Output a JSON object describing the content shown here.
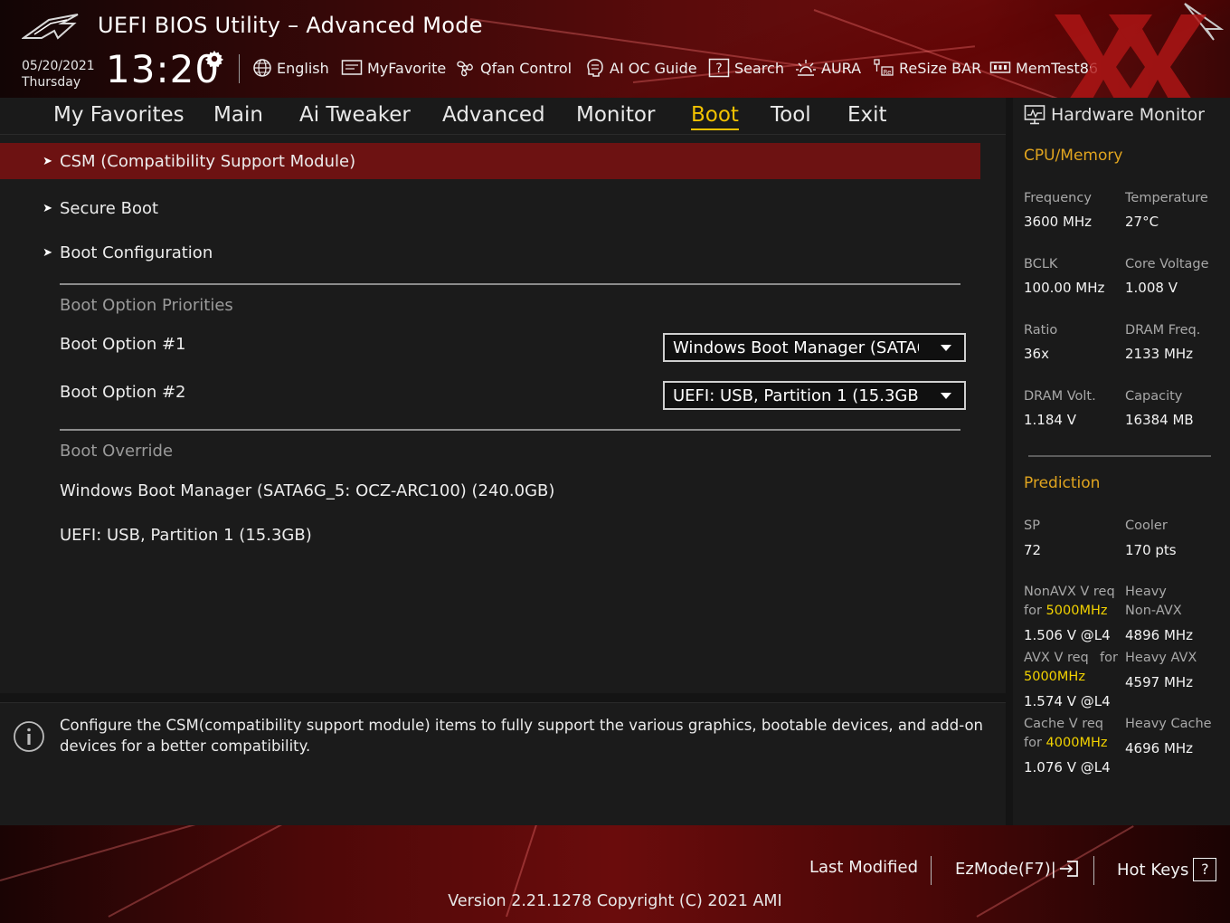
{
  "header": {
    "title": "UEFI BIOS Utility – Advanced Mode",
    "date": "05/20/2021",
    "weekday": "Thursday",
    "time": "13:20",
    "toolbar": {
      "language": "English",
      "myfavorite": "MyFavorite",
      "qfan": "Qfan Control",
      "aioc": "AI OC Guide",
      "search": "Search",
      "aura": "AURA",
      "resize_bar": "ReSize BAR",
      "memtest": "MemTest86"
    }
  },
  "tabs": {
    "my_favorites": "My Favorites",
    "main": "Main",
    "ai_tweaker": "Ai Tweaker",
    "advanced": "Advanced",
    "monitor": "Monitor",
    "boot": "Boot",
    "tool": "Tool",
    "exit": "Exit",
    "active": "Boot"
  },
  "boot": {
    "menu": {
      "csm": "CSM (Compatibility Support Module)",
      "secure_boot": "Secure Boot",
      "boot_config": "Boot Configuration"
    },
    "priorities_header": "Boot Option Priorities",
    "option1_label": "Boot Option #1",
    "option1_value": "Windows Boot Manager (SATA6G_5: OCZ-ARC100) (240.0GB)",
    "option2_label": "Boot Option #2",
    "option2_value": "UEFI:  USB, Partition 1 (15.3GB)",
    "override_header": "Boot Override",
    "override_1": "Windows Boot Manager (SATA6G_5: OCZ-ARC100) (240.0GB)",
    "override_2": "UEFI:  USB, Partition 1 (15.3GB)"
  },
  "info": {
    "text": "Configure the CSM(compatibility support module) items to fully support the various graphics, bootable devices, and add-on devices for a better compatibility."
  },
  "hwmon": {
    "title": "Hardware Monitor",
    "cpu_section": "CPU/Memory",
    "frequency_label": "Frequency",
    "frequency_value": "3600 MHz",
    "temperature_label": "Temperature",
    "temperature_value": "27°C",
    "bclk_label": "BCLK",
    "bclk_value": "100.00 MHz",
    "core_voltage_label": "Core Voltage",
    "core_voltage_value": "1.008 V",
    "ratio_label": "Ratio",
    "ratio_value": "36x",
    "dram_freq_label": "DRAM Freq.",
    "dram_freq_value": "2133 MHz",
    "dram_volt_label": "DRAM Volt.",
    "dram_volt_value": "1.184 V",
    "capacity_label": "Capacity",
    "capacity_value": "16384 MB",
    "prediction_section": "Prediction",
    "sp_label": "SP",
    "sp_value": "72",
    "cooler_label": "Cooler",
    "cooler_value": "170 pts",
    "nonavx_label_1": "NonAVX V req",
    "nonavx_label_2": "for ",
    "nonavx_freq": "5000MHz",
    "nonavx_value": "1.506 V @L4",
    "heavy_nonavx_label_1": "Heavy",
    "heavy_nonavx_label_2": "Non-AVX",
    "heavy_nonavx_value": "4896 MHz",
    "avx_label_1": "AVX V req",
    "avx_label_for": "for",
    "avx_freq": "5000MHz",
    "avx_value": "1.574 V @L4",
    "heavy_avx_label": "Heavy AVX",
    "heavy_avx_value": "4597 MHz",
    "cache_label_1": "Cache V req",
    "cache_label_2": "for ",
    "cache_freq": "4000MHz",
    "cache_value": "1.076 V @L4",
    "heavy_cache_label": "Heavy Cache",
    "heavy_cache_value": "4696 MHz"
  },
  "footer": {
    "last_modified": "Last Modified",
    "ezmode": "EzMode(F7)|",
    "hotkeys": "Hot Keys",
    "hotkeys_glyph": "?",
    "version": "Version 2.21.1278 Copyright (C) 2021 AMI"
  },
  "colors": {
    "accent_yellow": "#f2c200",
    "section_orange": "#e0a41f",
    "selected_row": "#6d1212",
    "header_red": "#6e0d0d"
  },
  "icons": [
    "rog-logo-icon",
    "gear-icon",
    "globe-icon",
    "favorite-icon",
    "fan-icon",
    "ai-oc-icon",
    "search-icon",
    "aura-icon",
    "resize-bar-icon",
    "memtest-icon",
    "monitor-icon",
    "info-icon",
    "exit-ezmode-icon",
    "help-icon"
  ]
}
